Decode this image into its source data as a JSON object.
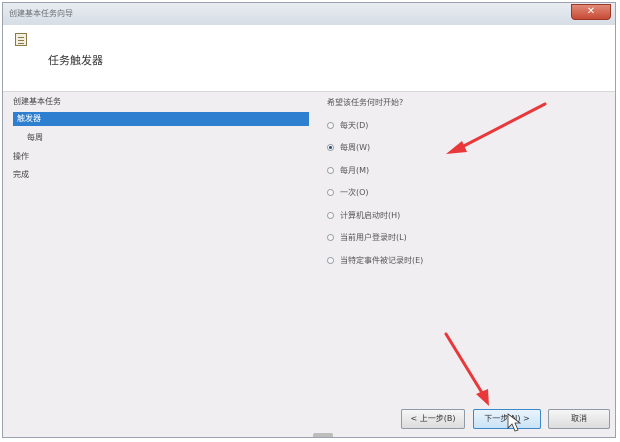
{
  "window": {
    "title": "创建基本任务向导"
  },
  "header": {
    "title": "任务触发器"
  },
  "nav": {
    "items": [
      {
        "label": "创建基本任务"
      },
      {
        "label": "触发器"
      },
      {
        "label": "每周"
      },
      {
        "label": "操作"
      },
      {
        "label": "完成"
      }
    ]
  },
  "content": {
    "question": "希望该任务何时开始?",
    "options": [
      {
        "label": "每天(D)",
        "selected": false
      },
      {
        "label": "每周(W)",
        "selected": true
      },
      {
        "label": "每月(M)",
        "selected": false
      },
      {
        "label": "一次(O)",
        "selected": false
      },
      {
        "label": "计算机启动时(H)",
        "selected": false
      },
      {
        "label": "当前用户登录时(L)",
        "selected": false
      },
      {
        "label": "当特定事件被记录时(E)",
        "selected": false
      }
    ]
  },
  "buttons": {
    "back": "< 上一步(B)",
    "next": "下一步(N) >",
    "cancel": "取消"
  },
  "annotation_color": "#e8383a"
}
